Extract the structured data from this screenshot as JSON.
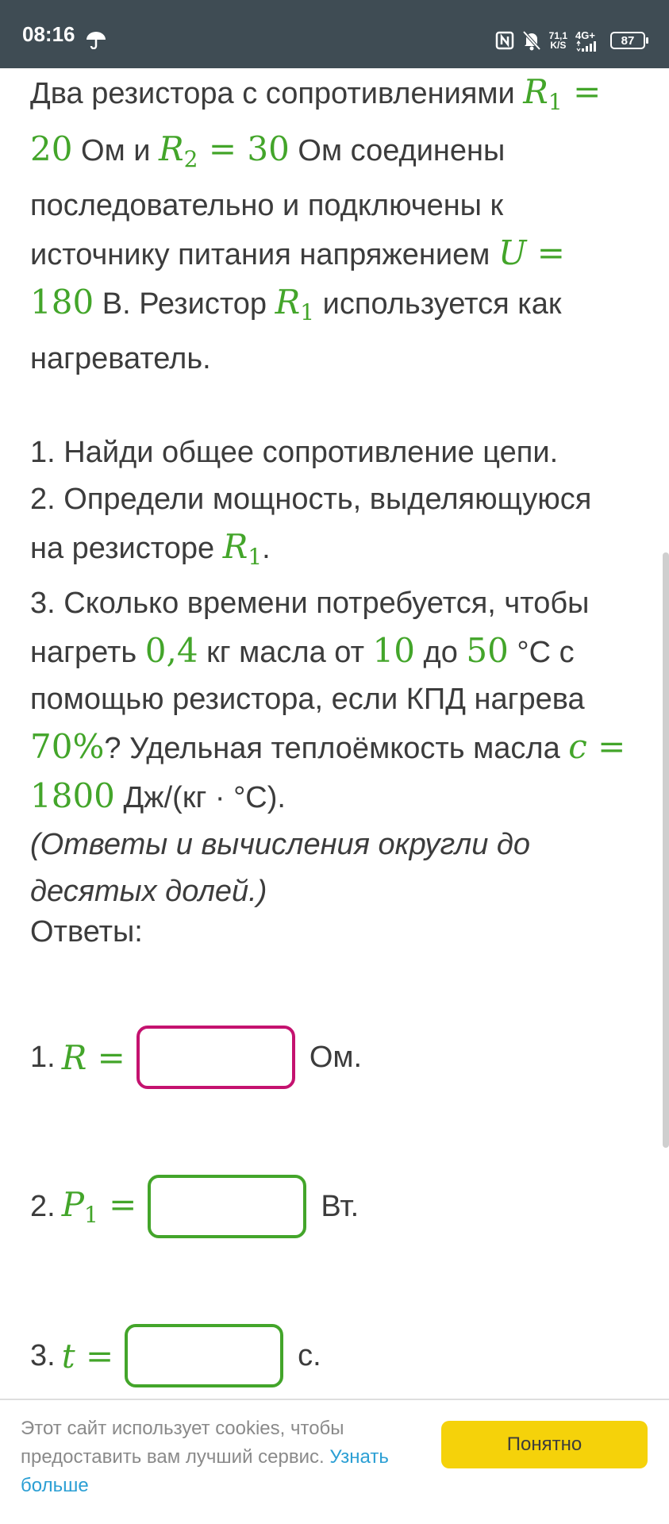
{
  "status_bar": {
    "time": "08:16",
    "net_speed_value": "71,1",
    "net_speed_unit": "K/S",
    "network": "4G+",
    "battery": "87",
    "icons": [
      "umbrella-icon",
      "nfc-icon",
      "mute-icon",
      "signal-icon",
      "battery-icon"
    ]
  },
  "problem": {
    "intro": {
      "t1": "Два резистора с сопротивлениями ",
      "r1_sym": "R",
      "r1_sub": "1",
      "eq1": " = ",
      "r1_val": "20",
      "t2": " Ом и ",
      "r2_sym": "R",
      "r2_sub": "2",
      "eq2": " = ",
      "r2_val": "30",
      "t3": " Ом соединены последовательно и подключены к источнику питания напряжением ",
      "u_sym": "U",
      "eq3": " = ",
      "u_val": "180",
      "t4": " В. Резистор ",
      "r1b_sym": "R",
      "r1b_sub": "1",
      "t5": " используется как нагреватель."
    },
    "q1": {
      "num": "1.",
      "text": " Найди общее сопротивление цепи."
    },
    "q2": {
      "num": "2.",
      "text": " Определи мощность, выделяющуюся на резисторе ",
      "sym": "R",
      "sub": "1",
      "end": "."
    },
    "q3": {
      "num": "3.",
      "t1": " Сколько времени потребуется, чтобы нагреть ",
      "mass": "0,4",
      "t2": " кг масла от ",
      "temp1": "10",
      "t3": " до ",
      "temp2": "50",
      "t4": " °C с помощью резистора, если КПД нагрева ",
      "eff": "70",
      "pct": "%",
      "t5": "? Удельная теплоёмкость масла ",
      "c_sym": "c",
      "eq": " = ",
      "c_val": "1800",
      "t6": " Дж/(кг · °C)."
    },
    "note": "(Ответы и вычисления округли до десятых долей.)"
  },
  "answers": {
    "heading": "Ответы:",
    "a1": {
      "num": "1.",
      "sym": "R",
      "sub": "",
      "eq": " = ",
      "unit": "Ом.",
      "value": ""
    },
    "a2": {
      "num": "2.",
      "sym": "P",
      "sub": "1",
      "eq": " = ",
      "unit": "Вт.",
      "value": ""
    },
    "a3": {
      "num": "3.",
      "sym": "t",
      "sub": "",
      "eq": " = ",
      "unit": "с.",
      "value": ""
    }
  },
  "cookie": {
    "text": "Этот сайт использует cookies, чтобы предоставить вам лучший сервис. ",
    "link": "Узнать больше",
    "button": "Понятно"
  },
  "colors": {
    "math_green": "#43a52a",
    "active_border": "#c4126f",
    "status_bg": "#3f4c54",
    "button_yellow": "#f5d20a",
    "link_blue": "#2b9fd4"
  }
}
